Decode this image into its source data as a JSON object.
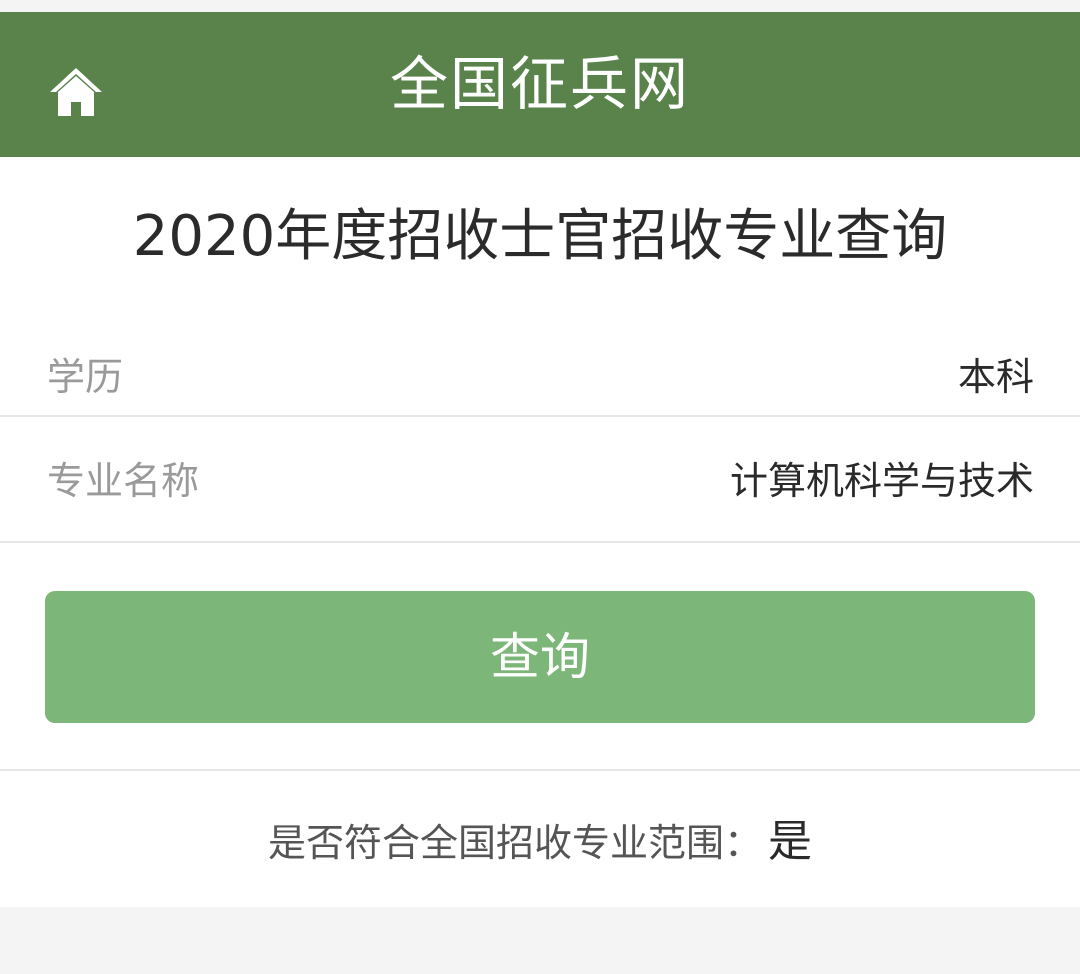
{
  "header": {
    "title": "全国征兵网",
    "home_icon": "home-icon",
    "background_color": "#5a834c"
  },
  "page": {
    "title": "2020年度招收士官招收专业查询"
  },
  "form": {
    "education": {
      "label": "学历",
      "value": "本科"
    },
    "major": {
      "label": "专业名称",
      "value": "计算机科学与技术"
    },
    "query_button_label": "查询",
    "button_color": "#7db679"
  },
  "result": {
    "label": "是否符合全国招收专业范围：",
    "value": "是"
  }
}
